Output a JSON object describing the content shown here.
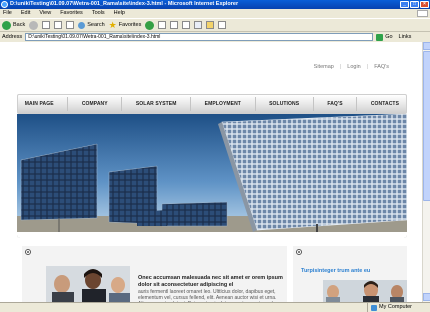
{
  "browser": {
    "title": "D:\\unik\\Testing\\01.09.07\\Wetra-001_Rama\\site\\index-3.html - Microsoft Internet Explorer",
    "menu": [
      "File",
      "Edit",
      "View",
      "Favorites",
      "Tools",
      "Help"
    ],
    "toolbar": {
      "back_label": "Back",
      "search_label": "Search",
      "favorites_label": "Favorites"
    },
    "address": {
      "label": "Address",
      "value": "D:\\unik\\Testing\\01.09.07\\Wetra-001_Rama\\site\\index-3.html",
      "go_label": "Go",
      "links_label": "Links"
    },
    "status": {
      "zone_label": "My Computer"
    }
  },
  "site": {
    "top_links": [
      "Sitemap",
      "Login",
      "FAQ's"
    ],
    "nav": [
      "MAIN PAGE",
      "COMPANY",
      "SOLAR SYSTEM",
      "EMPLOYMENT",
      "SOLUTIONS",
      "FAQ'S",
      "CONTACTS"
    ],
    "article": {
      "lead": "Onec accumsan malesuada nec sit amet er orem ipsum dolor sit aconsectetuer adipiscing el",
      "body": "auris fermentl laoreet ornaret leo. Ulttlcius dolor, dapibus eget, elementum vel, cursus fellend, elit. Aenean auctor wisi et urna. Aliquam erat volutpat. Duis ac turpis. Integer rutrum ante eu lacus. Quisque nulla"
    },
    "side": {
      "title": "Turpisinteger trum ante eu"
    }
  }
}
